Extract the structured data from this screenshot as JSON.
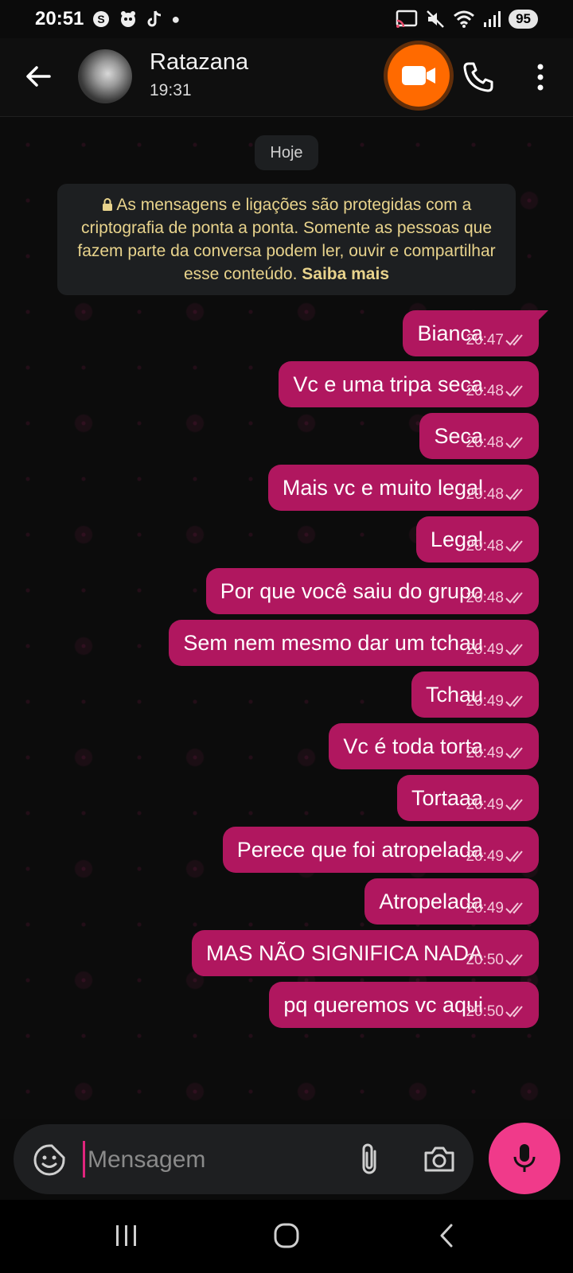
{
  "status_bar": {
    "time": "20:51",
    "left_icons": [
      "skype-icon",
      "mascot-icon",
      "tiktok-icon",
      "dot-icon"
    ],
    "right_icons": [
      "cast-icon",
      "mute-icon",
      "wifi-icon",
      "signal-icon"
    ],
    "battery": "95"
  },
  "header": {
    "contact_name": "Ratazana",
    "subtitle": "19:31",
    "video_call_highlight_color": "#ff6a00"
  },
  "chat": {
    "date_chip": "Hoje",
    "encryption_notice": {
      "text": "As mensagens e ligações são protegidas com a criptografia de ponta a ponta. Somente as pessoas que fazem parte da conversa podem ler, ouvir e compartilhar esse conteúdo.",
      "link": "Saiba mais"
    },
    "messages": [
      {
        "text": "Bianca",
        "time": "20:47"
      },
      {
        "text": "Vc e uma tripa seca",
        "time": "20:48"
      },
      {
        "text": "Seca",
        "time": "20:48"
      },
      {
        "text": "Mais vc e muito legal",
        "time": "20:48"
      },
      {
        "text": "Legal",
        "time": "20:48"
      },
      {
        "text": "Por que você saiu do grupo",
        "time": "20:48"
      },
      {
        "text": "Sem nem mesmo dar um tchau",
        "time": "20:49"
      },
      {
        "text": "Tchau",
        "time": "20:49"
      },
      {
        "text": "Vc é toda torta",
        "time": "20:49"
      },
      {
        "text": "Tortaaa",
        "time": "20:49"
      },
      {
        "text": "Perece que foi atropelada",
        "time": "20:49"
      },
      {
        "text": "Atropelada",
        "time": "20:49"
      },
      {
        "text": "MAS NÃO SIGNIFICA NADA",
        "time": "20:50"
      },
      {
        "text": "pq queremos vc aqui",
        "time": "20:50"
      }
    ],
    "bubble_color": "#b0175f"
  },
  "composer": {
    "placeholder": "Mensagem",
    "mic_color": "#f03a8a"
  },
  "nav_bar": {
    "buttons": [
      "recent-apps-icon",
      "home-icon",
      "back-icon"
    ]
  }
}
